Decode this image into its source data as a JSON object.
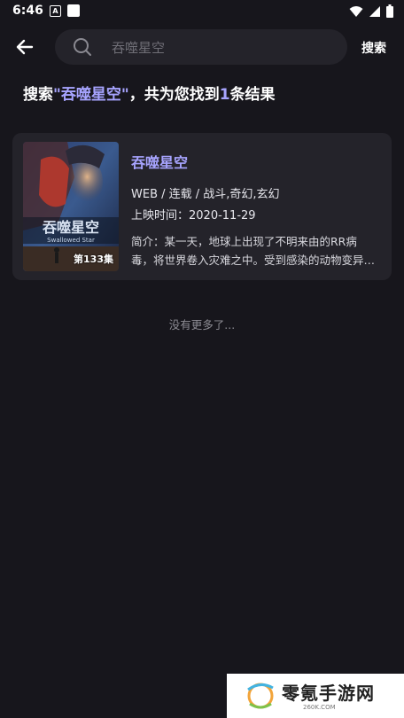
{
  "status_bar": {
    "time": "6:46",
    "notif_a": "A"
  },
  "header": {
    "search": {
      "placeholder": "吞噬星空",
      "value": ""
    },
    "search_button": "搜索"
  },
  "result_summary": {
    "prefix": "搜索",
    "keyword": "\"吞噬星空\"",
    "middle": "，共为您找到",
    "count": "1",
    "suffix": "条结果"
  },
  "results": [
    {
      "title": "吞噬星空",
      "meta": "WEB / 连载 / 战斗,奇幻,玄幻",
      "date": "上映时间：2020-11-29",
      "desc": "简介：某一天，地球上出现了不明来由的RR病毒，将世界卷入灾难之中。受到感染的动物变异，化身为怪物",
      "poster_episodes": "第133集",
      "poster_title": "吞噬星空",
      "poster_subtitle": "Swallowed Star"
    }
  ],
  "footer_text": "没有更多了...",
  "watermark": {
    "name": "零氪手游网",
    "sub": "260K.COM"
  },
  "colors": {
    "bg": "#17161c",
    "card": "#24232a",
    "accent": "#a7a4ff"
  }
}
